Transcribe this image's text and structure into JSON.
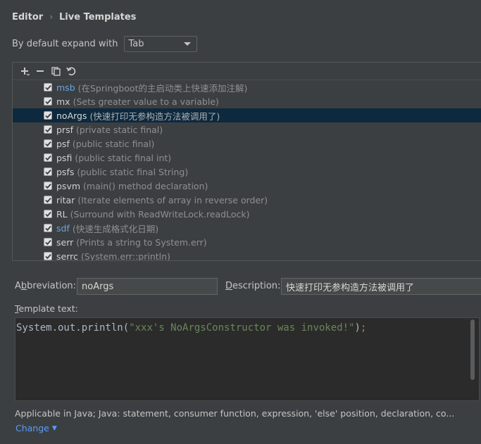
{
  "breadcrumb": {
    "root": "Editor",
    "current": "Live Templates"
  },
  "expand": {
    "label": "By default expand with",
    "value": "Tab"
  },
  "toolbar": {
    "add_icon": "plus-icon",
    "remove_icon": "minus-icon",
    "copy_icon": "copy-icon",
    "restore_icon": "undo-icon"
  },
  "templates": [
    {
      "abbr": "msb",
      "desc": "(在Springboot的主启动类上快速添加注解)",
      "checked": true,
      "color": "blue"
    },
    {
      "abbr": "mx",
      "desc": "(Sets greater value to a variable)",
      "checked": true,
      "color": "normal"
    },
    {
      "abbr": "noArgs",
      "desc": "(快速打印无参构造方法被调用了)",
      "checked": true,
      "color": "normal",
      "selected": true
    },
    {
      "abbr": "prsf",
      "desc": "(private static final)",
      "checked": true,
      "color": "normal"
    },
    {
      "abbr": "psf",
      "desc": "(public static final)",
      "checked": true,
      "color": "normal"
    },
    {
      "abbr": "psfi",
      "desc": "(public static final int)",
      "checked": true,
      "color": "normal"
    },
    {
      "abbr": "psfs",
      "desc": "(public static final String)",
      "checked": true,
      "color": "normal"
    },
    {
      "abbr": "psvm",
      "desc": "(main() method declaration)",
      "checked": true,
      "color": "normal"
    },
    {
      "abbr": "ritar",
      "desc": "(Iterate elements of array in reverse order)",
      "checked": true,
      "color": "normal"
    },
    {
      "abbr": "RL",
      "desc": "(Surround with ReadWriteLock.readLock)",
      "checked": true,
      "color": "normal"
    },
    {
      "abbr": "sdf",
      "desc": "(快速生成格式化日期)",
      "checked": true,
      "color": "blue"
    },
    {
      "abbr": "serr",
      "desc": "(Prints a string to System.err)",
      "checked": true,
      "color": "normal"
    },
    {
      "abbr": "serrc",
      "desc": "(System.err::println)",
      "checked": true,
      "color": "normal"
    }
  ],
  "form": {
    "abbreviation_label_pre": "A",
    "abbreviation_label_u": "b",
    "abbreviation_label_post": "breviation:",
    "abbreviation_value": "noArgs",
    "description_label_u": "D",
    "description_label_post": "escription:",
    "description_value": "快速打印无参构造方法被调用了",
    "template_label_u": "T",
    "template_label_post": "emplate text:"
  },
  "code": {
    "prefix": "System.out.println(",
    "string": "\"xxx's NoArgsConstructor was invoked!\"",
    "suffix": ")",
    "semicolon": ";"
  },
  "applicable": "Applicable in Java; Java: statement, consumer function, expression, 'else' position, declaration, co...",
  "change_label": "Change",
  "colors": {
    "blue_abbr": "#6aa3dd",
    "selection": "#0d293e",
    "link": "#589df6",
    "string": "#6a8759"
  }
}
